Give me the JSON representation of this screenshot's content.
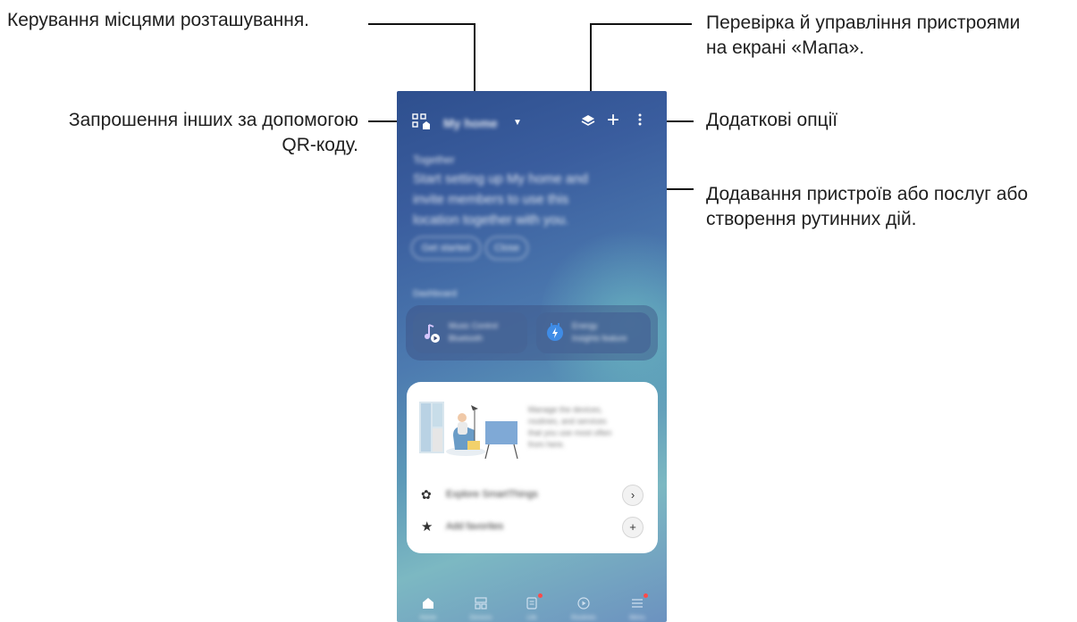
{
  "callouts": {
    "locations": "Керування місцями розташування.",
    "invite_line1": "Запрошення інших за допомогою",
    "invite_line2": "QR-коду.",
    "map_line1": "Перевірка й управління пристроями",
    "map_line2": "на екрані «Мапа».",
    "more": "Додаткові опції",
    "add_line1": "Додавання пристроїв або послуг або",
    "add_line2": "створення рутинних дій."
  },
  "phone": {
    "location_name": "My home",
    "welcome_title": "Together",
    "welcome_lines": [
      "Start setting up My home and",
      "invite members to use this",
      "location together with you."
    ],
    "chips": [
      "Get started",
      "Close"
    ],
    "section_label": "Dashboard",
    "fav_cards": [
      {
        "title": "Music Control",
        "subtitle": "Bluetooth"
      },
      {
        "title": "Energy",
        "subtitle": "Insights feature"
      }
    ],
    "card_text_lines": [
      "Manage the devices,",
      "routines, and services",
      "that you use most often",
      "from here."
    ],
    "card_items": [
      {
        "label": "Explore SmartThings"
      },
      {
        "label": "Add favorites"
      }
    ],
    "nav": [
      "Home",
      "Devices",
      "Life",
      "Routines",
      "Menu"
    ]
  },
  "colors": {
    "line": "#111111",
    "badge": "#ff4b4b"
  }
}
